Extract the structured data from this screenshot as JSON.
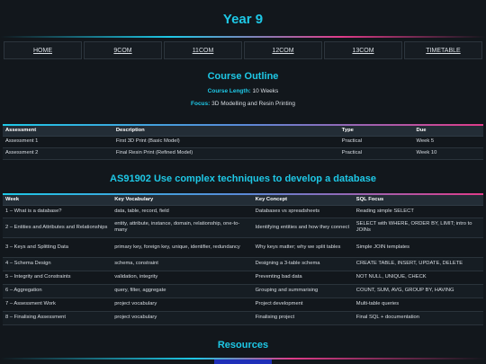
{
  "page": {
    "title": "Year 9"
  },
  "nav": {
    "items": [
      {
        "label": "HOME",
        "name": "nav-home"
      },
      {
        "label": "9COM",
        "name": "nav-9com"
      },
      {
        "label": "11COM",
        "name": "nav-11com"
      },
      {
        "label": "12COM",
        "name": "nav-12com"
      },
      {
        "label": "13COM",
        "name": "nav-13com"
      },
      {
        "label": "TIMETABLE",
        "name": "nav-timetable"
      }
    ]
  },
  "outline": {
    "title": "Course Outline",
    "length_label": "Course Length:",
    "length_value": "10 Weeks",
    "focus_label": "Focus:",
    "focus_value": "3D Modelling and Resin Printing"
  },
  "assessments": {
    "headers": [
      "Assessment",
      "Description",
      "Type",
      "Due"
    ],
    "rows": [
      [
        "Assessment 1",
        "First 3D Print (Basic Model)",
        "Practical",
        "Week 5"
      ],
      [
        "Assessment 2",
        "Final Resin Print (Refined Model)",
        "Practical",
        "Week 10"
      ]
    ]
  },
  "standard": {
    "title": "AS91902 Use complex techniques to develop a database",
    "headers": [
      "Week",
      "Key Vocabulary",
      "Key Concept",
      "SQL Focus"
    ],
    "rows": [
      [
        "1 – What is a database?",
        "data, table, record, field",
        "Databases vs spreadsheets",
        "Reading simple SELECT"
      ],
      [
        "2 – Entities and Attributes and Relationships",
        "entity, attribute, instance, domain, relationship, one-to-many",
        "Identifying entities and how they connect",
        "SELECT with WHERE, ORDER BY, LIMIT; intro to JOINs"
      ],
      [
        "3 – Keys and Splitting Data",
        "primary key, foreign key, unique, identifier, redundancy",
        "Why keys matter; why we split tables",
        "Simple JOIN templates"
      ],
      [
        "4 – Schema Design",
        "schema, constraint",
        "Designing a 3-table schema",
        "CREATE TABLE, INSERT, UPDATE, DELETE"
      ],
      [
        "5 – Integrity and Constraints",
        "validation, integrity",
        "Preventing bad data",
        "NOT NULL, UNIQUE, CHECK"
      ],
      [
        "6 – Aggregation",
        "query, filter, aggregate",
        "Grouping and summarising",
        "COUNT, SUM, AVG, GROUP BY, HAVING"
      ],
      [
        "7 – Assessment Work",
        "project vocabulary",
        "Project development",
        "Multi-table queries"
      ],
      [
        "8 – Finalising Assessment",
        "project vocabulary",
        "Finalising project",
        "Final SQL + documentation"
      ]
    ]
  },
  "resources": {
    "title": "Resources"
  }
}
